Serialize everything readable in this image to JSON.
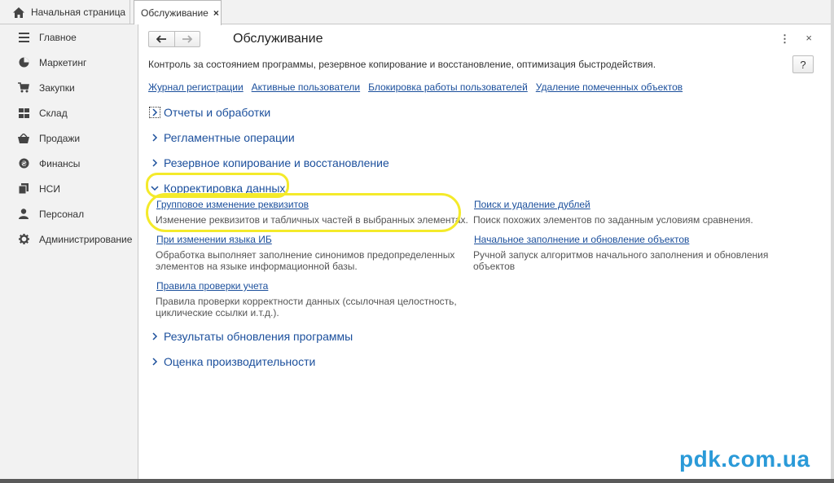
{
  "tabs": {
    "home_label": "Начальная страница",
    "active_label": "Обслуживание",
    "close_glyph": "×"
  },
  "sidebar": {
    "items": [
      {
        "label": "Главное",
        "icon": "menu-lines-icon"
      },
      {
        "label": "Маркетинг",
        "icon": "pie-chart-icon"
      },
      {
        "label": "Закупки",
        "icon": "cart-icon"
      },
      {
        "label": "Склад",
        "icon": "warehouse-grid-icon"
      },
      {
        "label": "Продажи",
        "icon": "basket-icon"
      },
      {
        "label": "Финансы",
        "icon": "coin-icon"
      },
      {
        "label": "НСИ",
        "icon": "documents-icon"
      },
      {
        "label": "Персонал",
        "icon": "person-icon"
      },
      {
        "label": "Администрирование",
        "icon": "gear-icon"
      }
    ]
  },
  "header": {
    "title": "Обслуживание",
    "more_glyph": "⋮",
    "close_glyph": "×",
    "help_glyph": "?"
  },
  "description": "Контроль за состоянием программы, резервное копирование и восстановление, оптимизация быстродействия.",
  "quick_links": [
    "Журнал регистрации",
    "Активные пользователи",
    "Блокировка работы пользователей",
    "Удаление помеченных объектов"
  ],
  "groups": {
    "reports": "Отчеты и обработки",
    "routine": "Регламентные операции",
    "backup": "Резервное копирование и восстановление",
    "correction": "Корректировка данных",
    "update_results": "Результаты обновления программы",
    "performance": "Оценка производительности"
  },
  "correction_items": [
    {
      "title": "Групповое изменение реквизитов",
      "description": "Изменение реквизитов и табличных частей в выбранных элементах."
    },
    {
      "title": "Поиск и удаление дублей",
      "description": "Поиск похожих элементов по заданным условиям сравнения."
    },
    {
      "title": "При изменении языка ИБ",
      "description_line1": "Обработка выполняет заполнение синонимов предопределенных",
      "description_line2": "элементов на языке информационной базы."
    },
    {
      "title": "Начальное заполнение и обновление объектов",
      "description_line1": "Ручной запуск алгоритмов начального заполнения и обновления",
      "description_line2": "объектов"
    },
    {
      "title": "Правила проверки учета",
      "description_line1": "Правила проверки корректности данных (ссылочная целостность,",
      "description_line2": "циклические ссылки и.т.д.)."
    }
  ],
  "watermark": "pdk.com.ua",
  "colors": {
    "link": "#1b4f9c",
    "highlight": "#f4ea2a",
    "watermark": "#2a9ad8",
    "panel_bg": "#f2f2f2"
  }
}
